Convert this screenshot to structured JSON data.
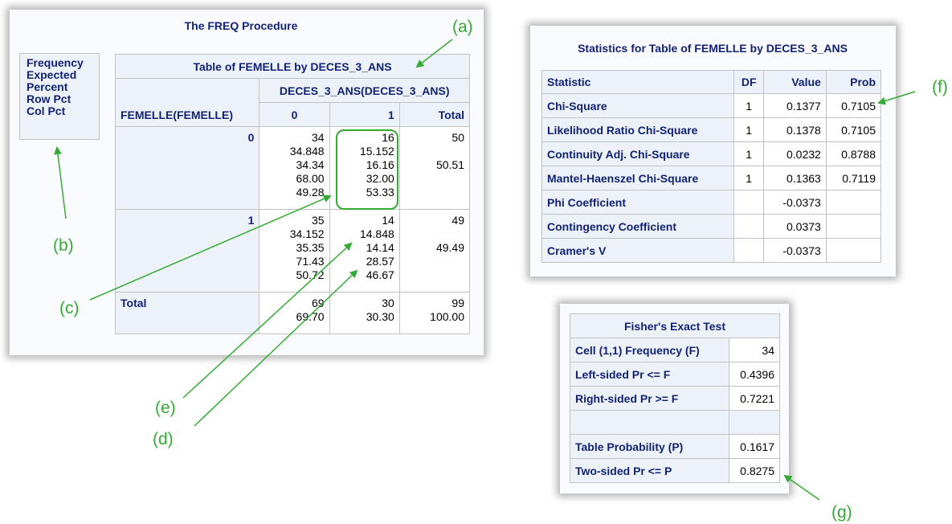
{
  "freq": {
    "title": "The FREQ Procedure",
    "legend": [
      "Frequency",
      "Expected",
      "Percent",
      "Row Pct",
      "Col Pct"
    ],
    "table_title": "Table of FEMELLE by DECES_3_ANS",
    "col_var": "DECES_3_ANS(DECES_3_ANS)",
    "row_var": "FEMELLE(FEMELLE)",
    "col_headers": [
      "0",
      "1",
      "Total"
    ],
    "rows": [
      {
        "label": "0",
        "c0": "34\n34.848\n34.34\n68.00\n49.28",
        "c1": "16\n15.152\n16.16\n32.00\n53.33",
        "total": "50\n\n50.51"
      },
      {
        "label": "1",
        "c0": "35\n34.152\n35.35\n71.43\n50.72",
        "c1": "14\n14.848\n14.14\n28.57\n46.67",
        "total": "49\n\n49.49"
      },
      {
        "label": "Total",
        "c0": "69\n69.70",
        "c1": "30\n30.30",
        "total": "99\n100.00"
      }
    ]
  },
  "stats": {
    "title": "Statistics for Table of FEMELLE by DECES_3_ANS",
    "headers": [
      "Statistic",
      "DF",
      "Value",
      "Prob"
    ],
    "rows": [
      [
        "Chi-Square",
        "1",
        "0.1377",
        "0.7105"
      ],
      [
        "Likelihood Ratio Chi-Square",
        "1",
        "0.1378",
        "0.7105"
      ],
      [
        "Continuity Adj. Chi-Square",
        "1",
        "0.0232",
        "0.8788"
      ],
      [
        "Mantel-Haenszel Chi-Square",
        "1",
        "0.1363",
        "0.7119"
      ],
      [
        "Phi Coefficient",
        "",
        "-0.0373",
        ""
      ],
      [
        "Contingency Coefficient",
        "",
        "0.0373",
        ""
      ],
      [
        "Cramer's V",
        "",
        "-0.0373",
        ""
      ]
    ]
  },
  "fisher": {
    "title": "Fisher's Exact Test",
    "rows": [
      [
        "Cell (1,1) Frequency (F)",
        "34"
      ],
      [
        "Left-sided Pr <= F",
        "0.4396"
      ],
      [
        "Right-sided Pr >= F",
        "0.7221"
      ],
      [
        "",
        ""
      ],
      [
        "Table Probability (P)",
        "0.1617"
      ],
      [
        "Two-sided Pr <= P",
        "0.8275"
      ]
    ]
  },
  "annotations": {
    "a": "(a)",
    "b": "(b)",
    "c": "(c)",
    "d": "(d)",
    "e": "(e)",
    "f": "(f)",
    "g": "(g)"
  },
  "colors": {
    "header_text": "#112277",
    "header_bg": "#edf2f9",
    "annotation": "#33aa33"
  }
}
